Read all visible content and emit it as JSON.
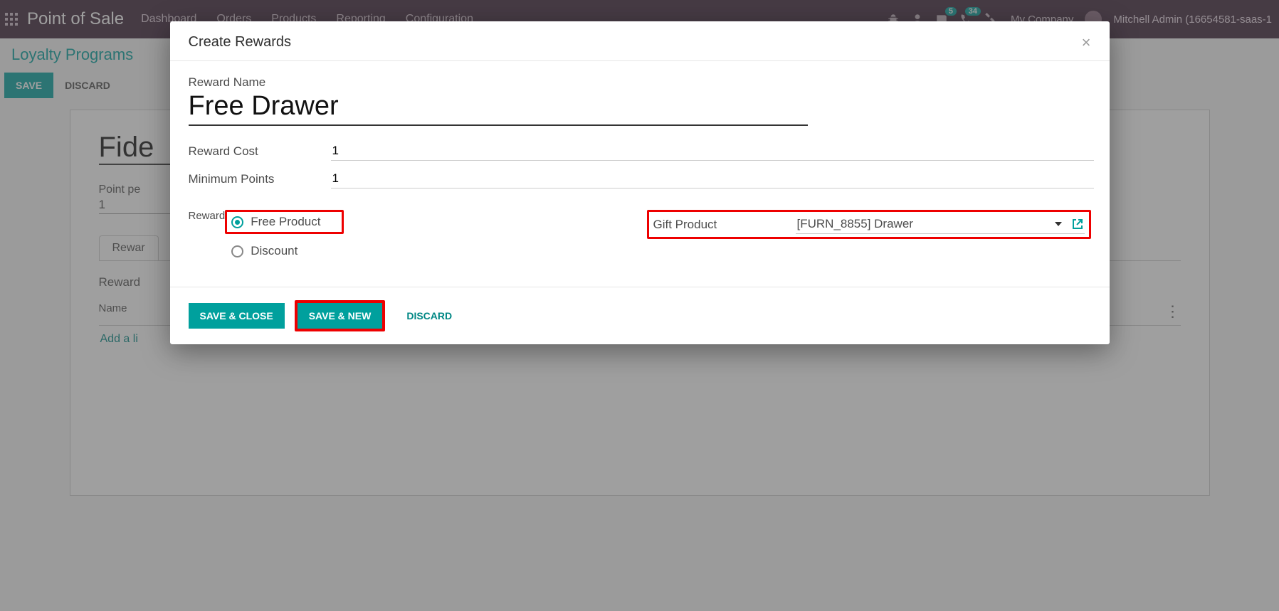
{
  "topbar": {
    "app_title": "Point of Sale",
    "nav": [
      "Dashboard",
      "Orders",
      "Products",
      "Reporting",
      "Configuration"
    ],
    "msg_badge": "5",
    "call_badge": "34",
    "company": "My Company",
    "user": "Mitchell Admin (16654581-saas-1"
  },
  "breadcrumb": "Loyalty Programs",
  "control": {
    "save": "SAVE",
    "discard": "DISCARD"
  },
  "sheet": {
    "title_visible": "Fide",
    "point_label": "Point pe",
    "point_value": "1",
    "tab": "Rewar",
    "section": "Reward",
    "col_name": "Name",
    "add_line": "Add a li"
  },
  "modal": {
    "title": "Create Rewards",
    "labels": {
      "name": "Reward Name",
      "cost": "Reward Cost",
      "min": "Minimum Points",
      "reward": "Reward",
      "gift": "Gift Product"
    },
    "values": {
      "name": "Free Drawer",
      "cost": "1",
      "min": "1",
      "gift": "[FURN_8855] Drawer"
    },
    "radios": {
      "free_product": "Free Product",
      "discount": "Discount"
    },
    "buttons": {
      "save_close": "SAVE & CLOSE",
      "save_new": "SAVE & NEW",
      "discard": "DISCARD"
    }
  }
}
